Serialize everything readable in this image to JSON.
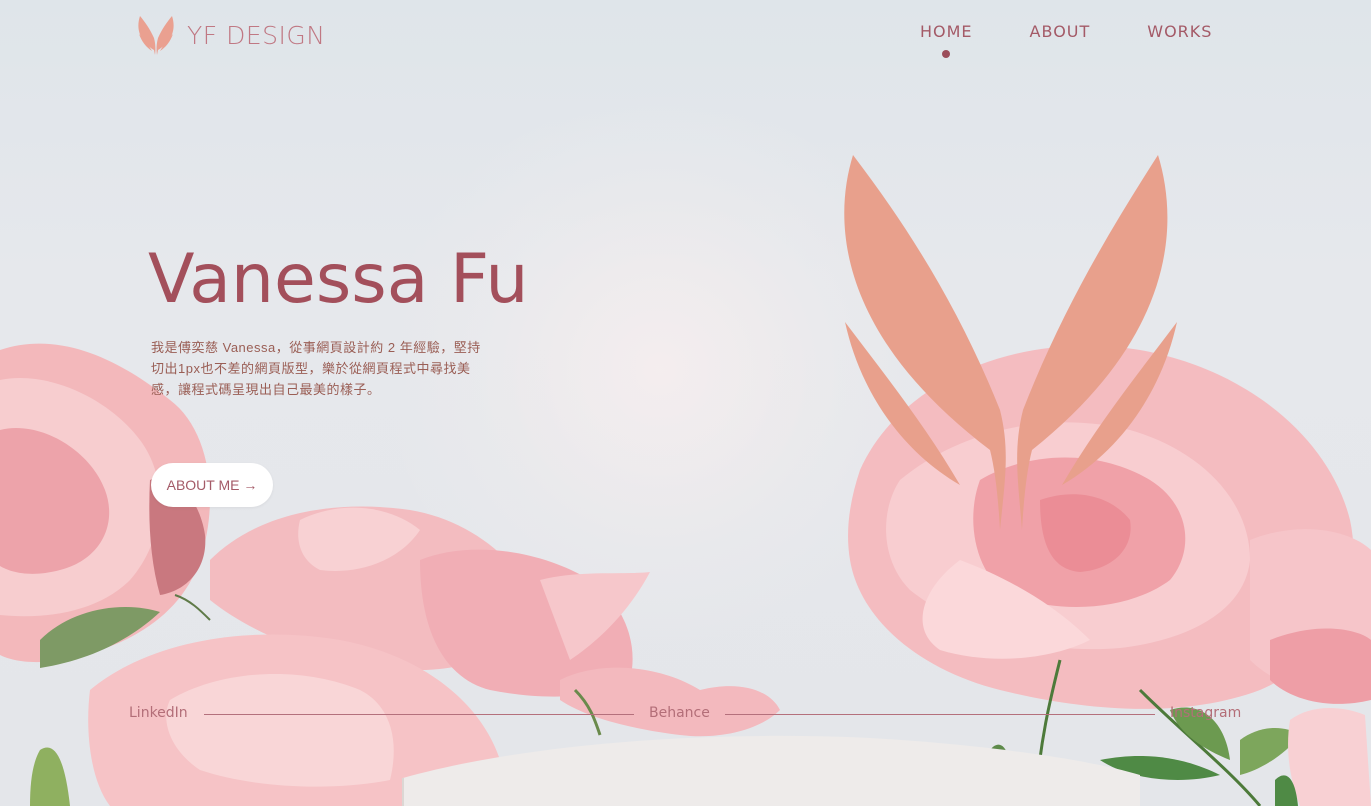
{
  "header": {
    "logo_text": "YF DESIGN",
    "nav": [
      {
        "label": "HOME",
        "active": true
      },
      {
        "label": "ABOUT",
        "active": false
      },
      {
        "label": "WORKS",
        "active": false
      }
    ]
  },
  "hero": {
    "name": "Vanessa Fu",
    "intro_lines": [
      "我是傅奕慈 Vanessa，從事網頁設計約 2 年經驗，堅持",
      "切出1px也不差的網頁版型，樂於從網頁程式中尋找美",
      "感，讓程式碼呈現出自己最美的樣子。"
    ],
    "cta_label": "ABOUT ME →"
  },
  "social": {
    "linkedin": "LinkedIn",
    "behance": "Behance",
    "instagram": "Instagram"
  },
  "colors": {
    "accent": "#a34f5b",
    "mark": "#e8a08c",
    "petal": "#f6c2c3"
  },
  "icons": {
    "logo": "leaf-wings-icon",
    "brand_mark": "leaf-wings-icon"
  }
}
